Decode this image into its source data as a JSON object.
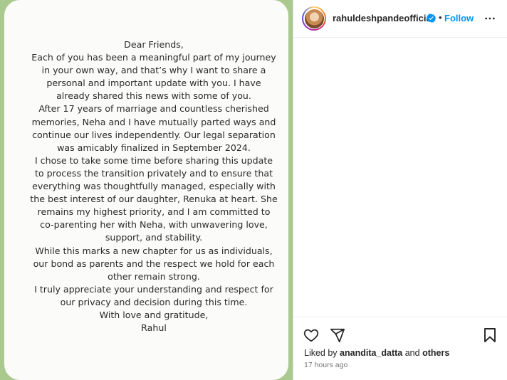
{
  "post": {
    "letter_lines": [
      "Dear Friends,",
      "Each of you has been a meaningful part of my journey",
      "in your own way, and that’s why I want to share a",
      "personal and important update with you. I have",
      "already shared this news with some of you.",
      "After 17 years of marriage and countless cherished",
      "memories, Neha and I have mutually parted ways and",
      "continue our lives independently. Our legal separation",
      "was amicably finalized in September 2024.",
      "I chose to take some time before sharing this update",
      "to process the transition privately and to ensure that",
      "everything was thoughtfully managed, especially with",
      "the best interest of our daughter, Renuka at heart. She",
      "remains my highest priority, and I am committed to",
      "co-parenting her with Neha, with unwavering love,",
      "support, and stability.",
      "While this marks a new chapter for us as individuals,",
      "our bond as parents and the respect we hold for each",
      "other remain strong.",
      "I truly appreciate your understanding and respect for",
      "our privacy and decision during this time.",
      "With love and gratitude,",
      "Rahul"
    ]
  },
  "header": {
    "username": "rahuldeshpandeofficial",
    "separator": "•",
    "follow_label": "Follow",
    "verified_icon": "verified-badge-icon",
    "more_icon": "more-options-icon"
  },
  "footer": {
    "liked_by_prefix": "Liked by ",
    "liked_by_user": "anandita_datta",
    "liked_by_and": " and ",
    "liked_by_others": "others",
    "timestamp": "17 hours ago"
  },
  "colors": {
    "accent": "#0095f6",
    "verified": "#0095f6",
    "media_border": "#a9c98f"
  }
}
